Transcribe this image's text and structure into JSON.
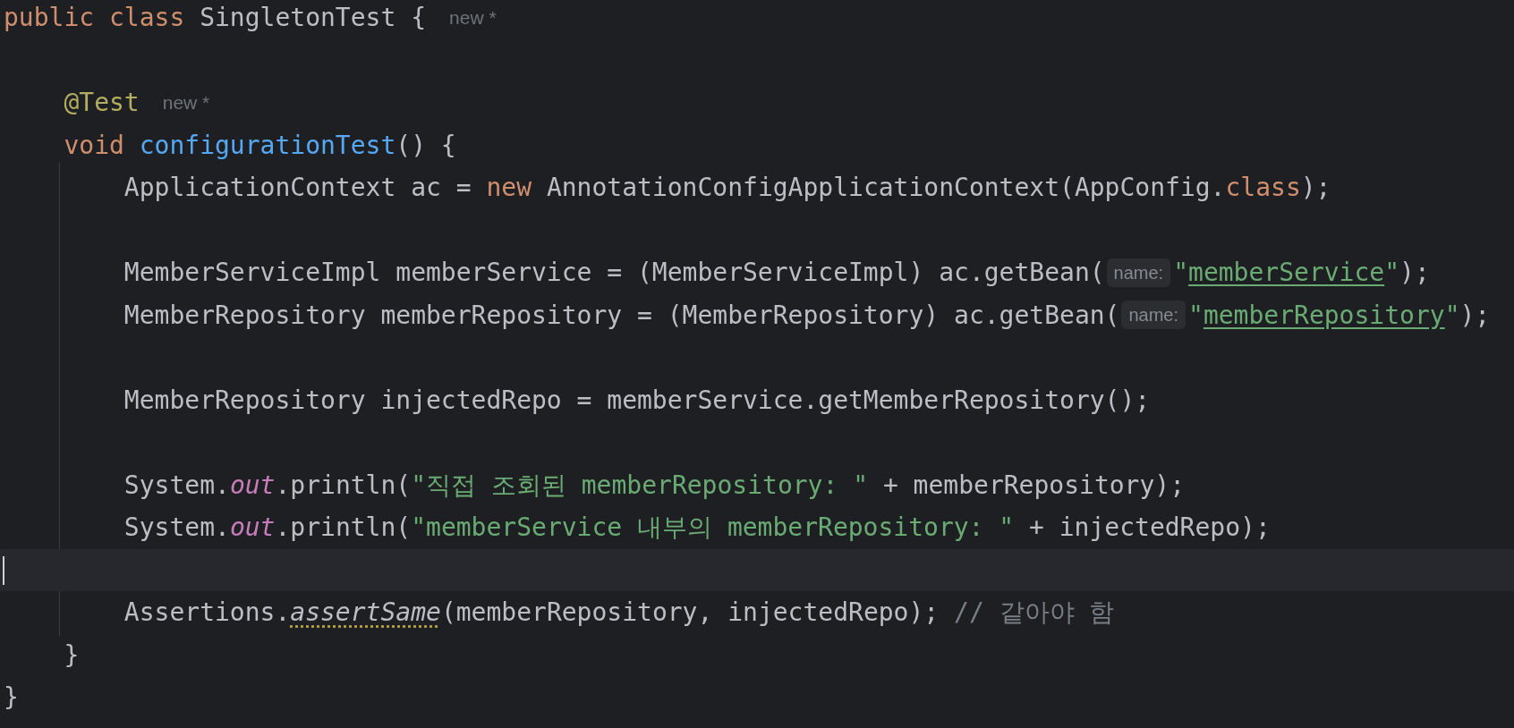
{
  "editor": {
    "lines": [
      {
        "current": false,
        "tokens": [
          {
            "kind": "keyword",
            "text": "public class "
          },
          {
            "kind": "plain",
            "text": "SingletonTest {"
          },
          {
            "kind": "author",
            "text": "new *"
          }
        ]
      },
      {
        "current": false
      },
      {
        "current": false,
        "tokens": [
          {
            "kind": "annotation",
            "text": "    @Test"
          },
          {
            "kind": "author",
            "text": "new *"
          }
        ]
      },
      {
        "current": false,
        "tokens": [
          {
            "kind": "keyword",
            "text": "    void "
          },
          {
            "kind": "method",
            "text": "configurationTest"
          },
          {
            "kind": "plain",
            "text": "() {"
          }
        ]
      },
      {
        "current": false,
        "tokens": [
          {
            "kind": "plain",
            "text": "        ApplicationContext ac = "
          },
          {
            "kind": "keyword",
            "text": "new "
          },
          {
            "kind": "plain",
            "text": "AnnotationConfigApplicationContext(AppConfig."
          },
          {
            "kind": "keyword",
            "text": "class"
          },
          {
            "kind": "plain",
            "text": ");"
          }
        ]
      },
      {
        "current": false
      },
      {
        "current": false,
        "tokens": [
          {
            "kind": "plain",
            "text": "        MemberServiceImpl memberService = (MemberServiceImpl) ac.getBean("
          },
          {
            "kind": "hint",
            "text": "name:"
          },
          {
            "kind": "string",
            "text": "\""
          },
          {
            "kind": "link-string",
            "text": "memberService"
          },
          {
            "kind": "string",
            "text": "\""
          },
          {
            "kind": "plain",
            "text": ");"
          }
        ]
      },
      {
        "current": false,
        "tokens": [
          {
            "kind": "plain",
            "text": "        MemberRepository memberRepository = (MemberRepository) ac.getBean("
          },
          {
            "kind": "hint",
            "text": "name:"
          },
          {
            "kind": "string",
            "text": "\""
          },
          {
            "kind": "link-string",
            "text": "memberRepository"
          },
          {
            "kind": "string",
            "text": "\""
          },
          {
            "kind": "plain",
            "text": ");"
          }
        ]
      },
      {
        "current": false
      },
      {
        "current": false,
        "tokens": [
          {
            "kind": "plain",
            "text": "        MemberRepository injectedRepo = memberService.getMemberRepository();"
          }
        ]
      },
      {
        "current": false
      },
      {
        "current": false,
        "tokens": [
          {
            "kind": "plain",
            "text": "        System."
          },
          {
            "kind": "field",
            "text": "out"
          },
          {
            "kind": "plain",
            "text": ".println("
          },
          {
            "kind": "string",
            "text": "\"직접 조회된 memberRepository: \""
          },
          {
            "kind": "plain",
            "text": " + memberRepository);"
          }
        ]
      },
      {
        "current": false,
        "tokens": [
          {
            "kind": "plain",
            "text": "        System."
          },
          {
            "kind": "field",
            "text": "out"
          },
          {
            "kind": "plain",
            "text": ".println("
          },
          {
            "kind": "string",
            "text": "\"memberService 내부의 memberRepository: \""
          },
          {
            "kind": "plain",
            "text": " + injectedRepo);"
          }
        ]
      },
      {
        "current": true
      },
      {
        "current": false,
        "tokens": [
          {
            "kind": "plain",
            "text": "        Assertions."
          },
          {
            "kind": "warning-call",
            "text": "assertSame"
          },
          {
            "kind": "plain",
            "text": "(memberRepository, injectedRepo); "
          },
          {
            "kind": "comment",
            "text": "// 같아야 함"
          }
        ]
      },
      {
        "current": false,
        "tokens": [
          {
            "kind": "plain",
            "text": "    }"
          }
        ]
      },
      {
        "current": false,
        "tokens": [
          {
            "kind": "plain",
            "text": "}"
          }
        ]
      }
    ]
  }
}
